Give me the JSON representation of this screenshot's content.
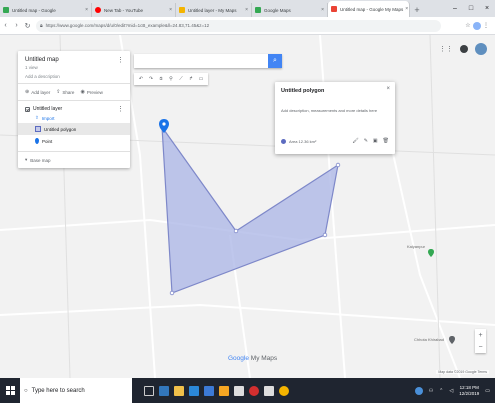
{
  "browser": {
    "tabs": [
      {
        "label": "Untitled map - Google",
        "color": "#34a853"
      },
      {
        "label": "New Tab - YouTube",
        "color": "#ff0000"
      },
      {
        "label": "Untitled layer - My Maps",
        "color": "#f4b400"
      },
      {
        "label": "Google Maps",
        "color": "#34a853"
      },
      {
        "label": "Untitled map - Google My Maps",
        "color": "#ea4335"
      }
    ],
    "url": "https://www.google.com/maps/d/u/0/edit?mid=1cB_example&ll=24.83,71.45&z=12"
  },
  "panel": {
    "title": "Untitled map",
    "views": "1 view",
    "description": "Add a description",
    "actions": [
      {
        "icon": "add-layer-icon",
        "label": "Add layer"
      },
      {
        "icon": "share-icon",
        "label": "Share"
      },
      {
        "icon": "preview-icon",
        "label": "Preview"
      }
    ],
    "layer": {
      "title": "Untitled layer",
      "import": "Import",
      "items": [
        {
          "type": "polygon",
          "label": "Untitled polygon",
          "selected": true
        },
        {
          "type": "pin",
          "label": "Point",
          "selected": false
        }
      ]
    },
    "basemap": "Base map"
  },
  "tools": [
    "undo-icon",
    "redo-icon",
    "hand-icon",
    "marker-icon",
    "line-icon",
    "route-icon",
    "ruler-icon"
  ],
  "card": {
    "title": "Untitled polygon",
    "description": "Add description, measurements and more details here",
    "measure": "Area 12.36 km²",
    "style_color": "#5c6bc0"
  },
  "map_labels": {
    "town_right": "Kalyanpur",
    "bottom_right": "Chhota Khirabad",
    "brand_word": "Google",
    "brand_suffix": "My Maps",
    "attribution": "Map data ©2019 Google  Terms"
  },
  "taskbar": {
    "search": "Type here to search",
    "time": "12:18 PM",
    "date": "12/2/2019"
  },
  "colors": {
    "polygon_fill": "#aab4e6",
    "polygon_stroke": "#7e88c9",
    "accent": "#4285f4",
    "taskbar": "#1f2530"
  }
}
